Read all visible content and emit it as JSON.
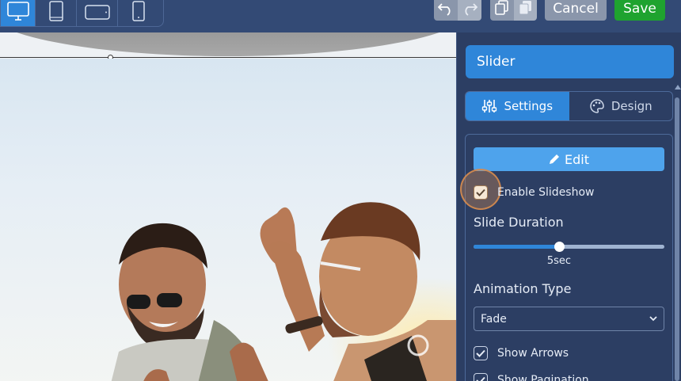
{
  "toolbar": {
    "devices": [
      "desktop-icon",
      "tablet-portrait-icon",
      "tablet-landscape-icon",
      "mobile-icon"
    ],
    "active_device": "desktop",
    "cancel_label": "Cancel",
    "save_label": "Save",
    "colors": {
      "bar": "#334a75",
      "active": "#2f86d9",
      "save": "#1fa32f",
      "cancel": "#8a96ab"
    }
  },
  "panel": {
    "title": "Slider",
    "tabs": [
      {
        "label": "Settings",
        "icon": "sliders-icon",
        "active": true
      },
      {
        "label": "Design",
        "icon": "palette-icon",
        "active": false
      }
    ],
    "edit_label": "Edit",
    "enable_slideshow": {
      "label": "Enable Slideshow",
      "checked": true
    },
    "slide_duration": {
      "label": "Slide Duration",
      "value_text": "5sec",
      "fraction": 0.45
    },
    "animation_type": {
      "label": "Animation Type",
      "selected": "Fade"
    },
    "show_arrows": {
      "label": "Show Arrows",
      "checked": true
    },
    "show_pagination": {
      "label": "Show Pagination",
      "checked": true
    }
  }
}
